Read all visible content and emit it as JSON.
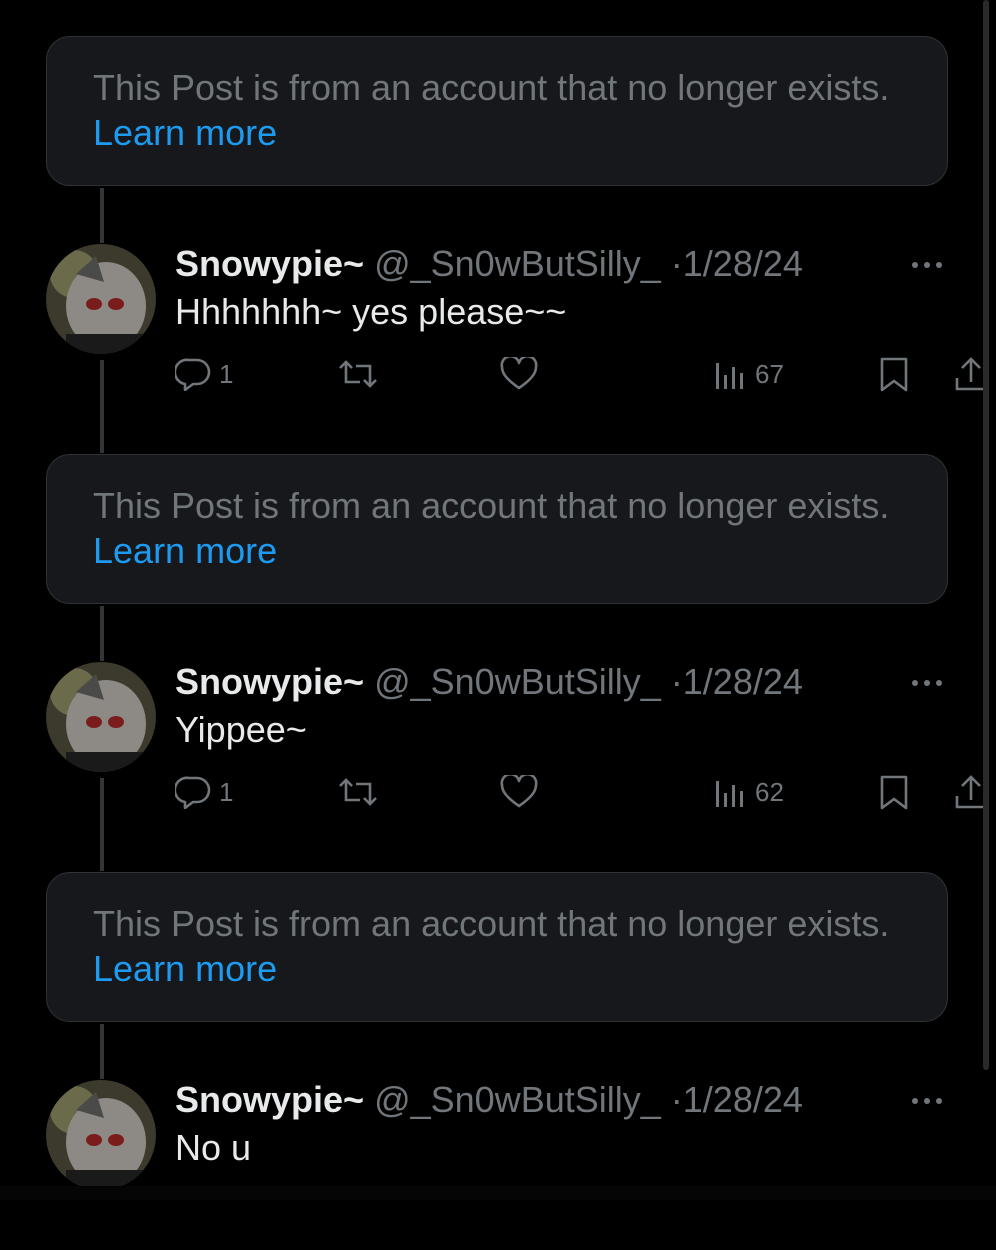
{
  "notices": [
    {
      "text": "This Post is from an account that no longer exists.",
      "link": "Learn more"
    },
    {
      "text": "This Post is from an account that no longer exists.",
      "link": "Learn more"
    },
    {
      "text": "This Post is from an account that no longer exists.",
      "link": "Learn more"
    }
  ],
  "posts": [
    {
      "name": "Snowypie~",
      "handle": "@_Sn0wButSilly_",
      "dot": "·",
      "date": "1/28/24",
      "text": "Hhhhhhh~ yes please~~",
      "reply_count": "1",
      "views": "67"
    },
    {
      "name": "Snowypie~",
      "handle": "@_Sn0wButSilly_",
      "dot": "·",
      "date": "1/28/24",
      "text": "Yippee~",
      "reply_count": "1",
      "views": "62"
    },
    {
      "name": "Snowypie~",
      "handle": "@_Sn0wButSilly_",
      "dot": "·",
      "date": "1/28/24",
      "text": "No u"
    }
  ],
  "icons": {
    "reply": "reply-icon",
    "repost": "repost-icon",
    "like": "like-icon",
    "views": "views-icon",
    "bookmark": "bookmark-icon",
    "share": "share-icon",
    "more": "more-icon"
  },
  "colors": {
    "background": "#000000",
    "card": "#16181c",
    "muted": "#71767b",
    "link": "#1d9bf0",
    "text": "#e7e9ea"
  }
}
